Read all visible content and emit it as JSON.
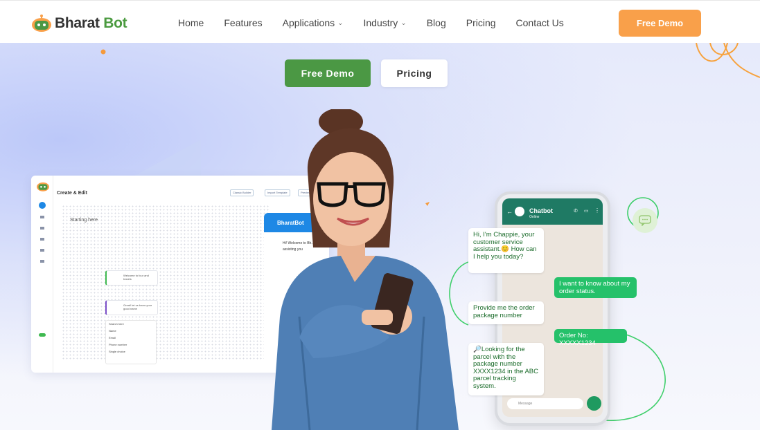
{
  "nav": {
    "logo_word1": "Bharat",
    "logo_word2": "Bot",
    "menu": [
      {
        "label": "Home",
        "dropdown": false
      },
      {
        "label": "Features",
        "dropdown": false
      },
      {
        "label": "Applications",
        "dropdown": true
      },
      {
        "label": "Industry",
        "dropdown": true
      },
      {
        "label": "Blog",
        "dropdown": false
      },
      {
        "label": "Pricing",
        "dropdown": false
      },
      {
        "label": "Contact Us",
        "dropdown": false
      }
    ],
    "cta": "Free Demo",
    "caret": "⌄"
  },
  "hero": {
    "primary_btn": "Free Demo",
    "secondary_btn": "Pricing"
  },
  "builder": {
    "title": "Create & Edit",
    "chips": [
      "Classic Builder",
      "Import Template",
      "Preview"
    ],
    "start_label": "Starting here",
    "node1": "Welcome to four and travels",
    "node2": "Great! let us know your good name",
    "list_search": "Search here",
    "list_items": [
      "Name",
      "Email",
      "Phone number",
      "Single choice"
    ],
    "chat_header": "BharatBot",
    "chat_msg": "Hi! Welcome to Bh... be assisting you"
  },
  "phone": {
    "bot_name": "Chatbot",
    "bot_status": "Online",
    "input_placeholder": "Message"
  },
  "chat": [
    {
      "dir": "in",
      "text": "Hi, I'm Chappie, your customer service assistant.😊 How can I help you today?"
    },
    {
      "dir": "out",
      "text": "I want to know about my order status."
    },
    {
      "dir": "in",
      "text": "Provide me the order package number"
    },
    {
      "dir": "out",
      "text": "Order No: XXXXX1234"
    },
    {
      "dir": "in",
      "text": "🔎Looking for the parcel with the package number XXXX1234 in the ABC parcel tracking system."
    }
  ],
  "colors": {
    "brand_orange": "#f9a04a",
    "brand_green": "#4b9844",
    "whatsapp_header": "#1f7a64",
    "bubble_out": "#25c16a"
  }
}
